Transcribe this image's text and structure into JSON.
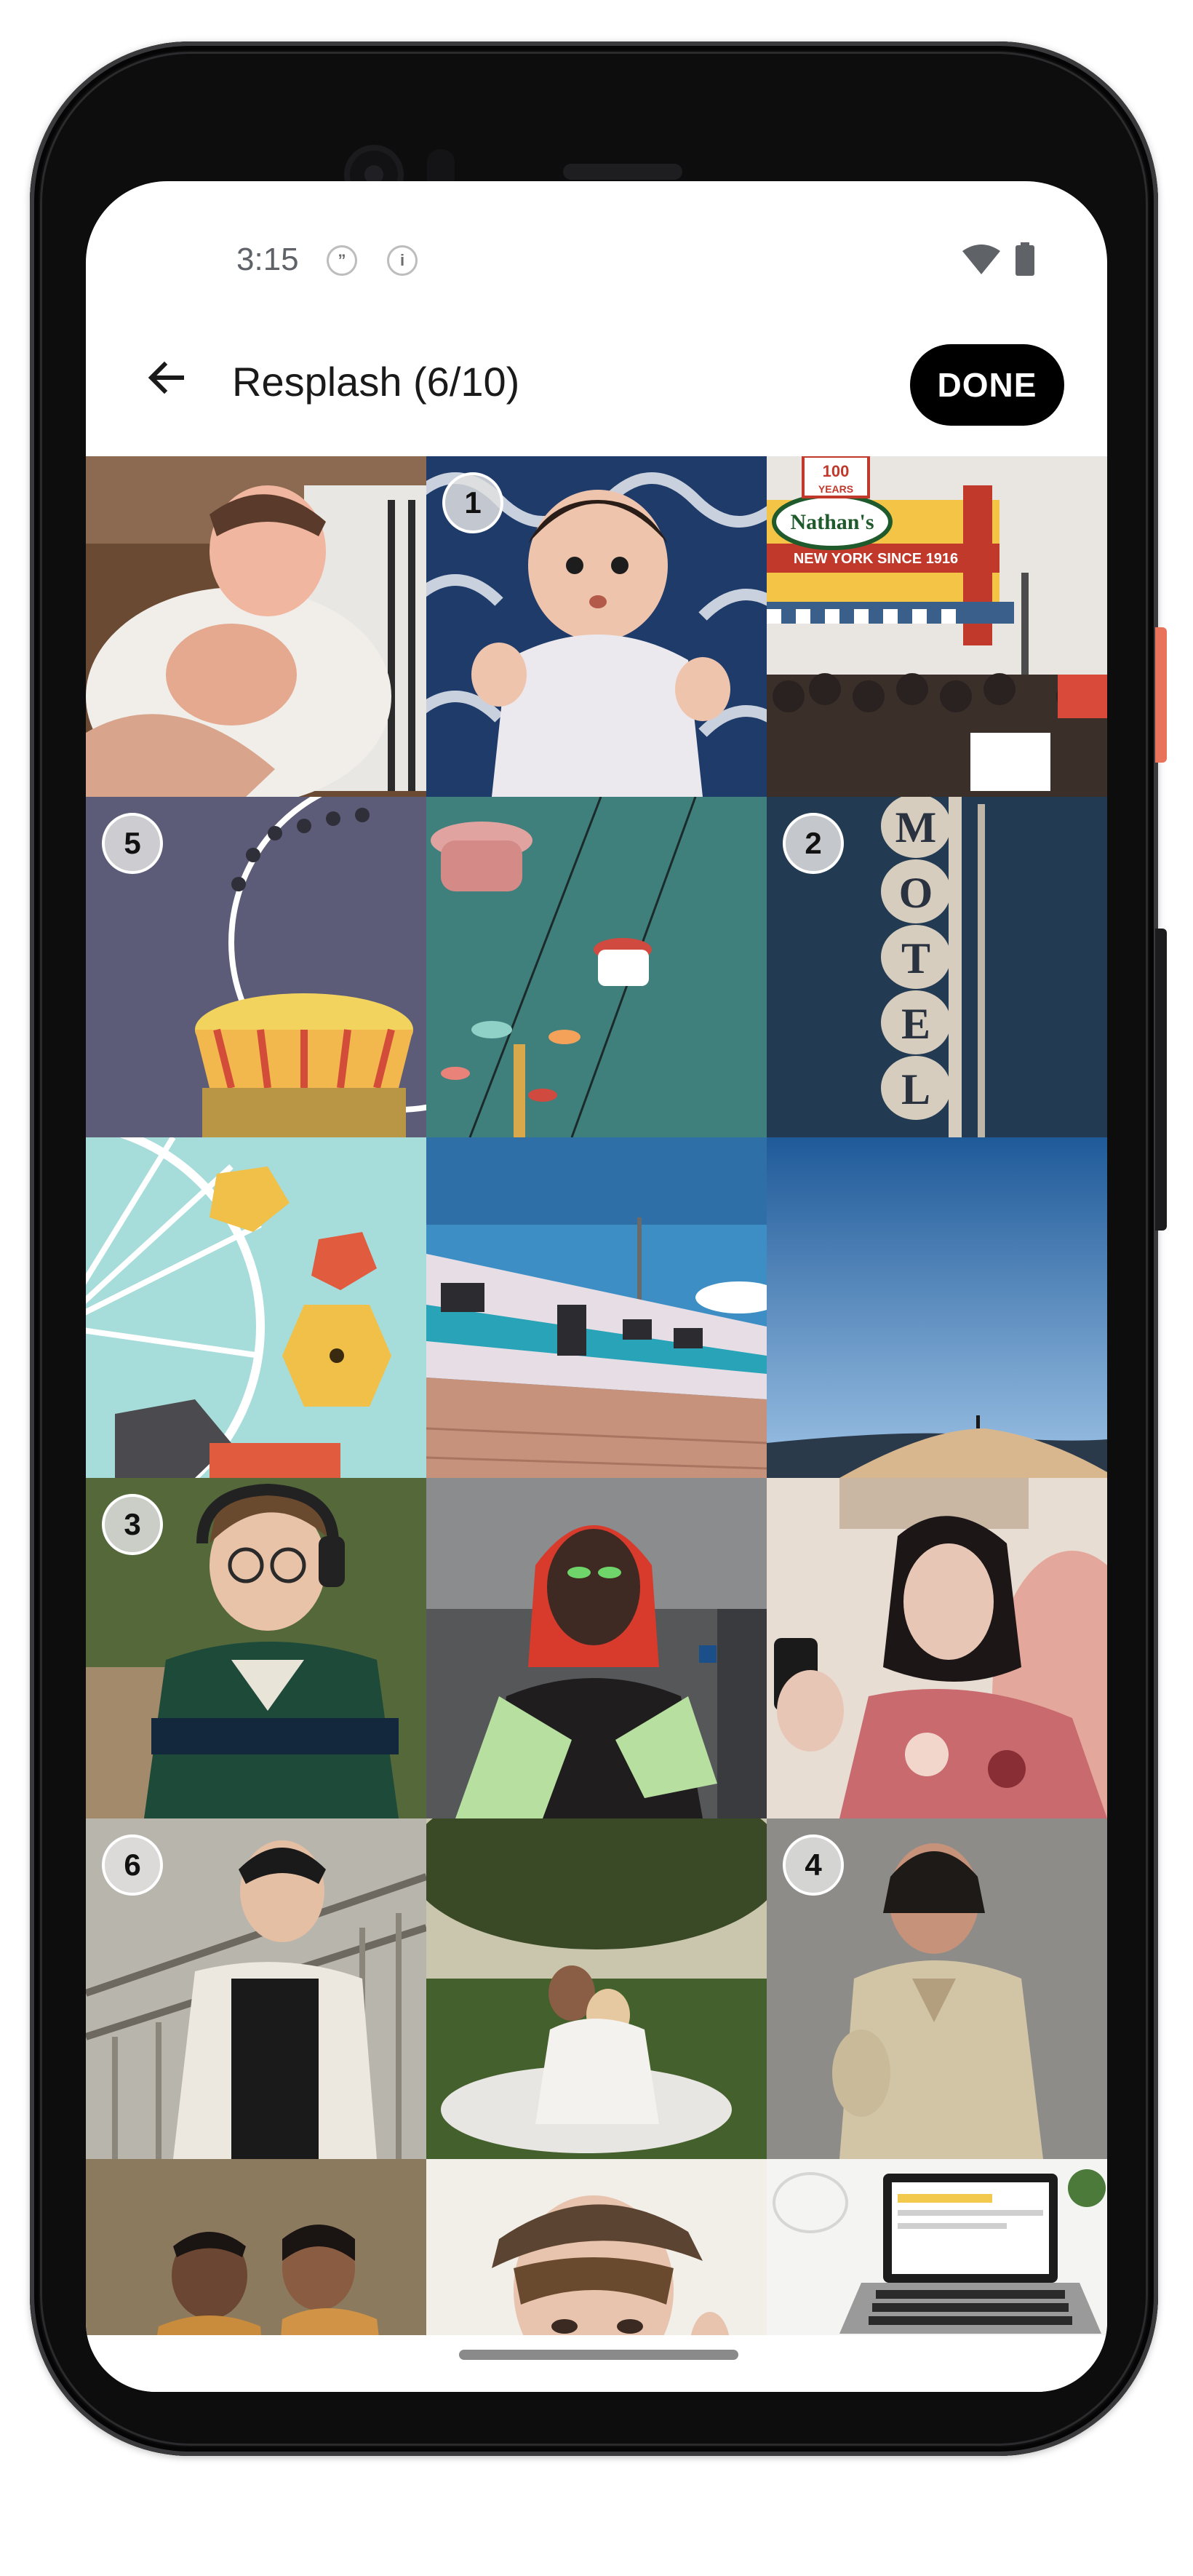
{
  "status_bar": {
    "time": "3:15",
    "notification_icons": [
      "quote-icon",
      "info-icon"
    ],
    "wifi_icon": "wifi-icon",
    "battery_icon": "battery-icon"
  },
  "app_bar": {
    "back_icon": "arrow-left-icon",
    "title": "Resplash (6/10)",
    "done_label": "DONE"
  },
  "colors": {
    "accent": "#000000",
    "badge": "#e1e1e1",
    "phone_side_button": "#e8735a"
  },
  "grid": {
    "tiles": [
      {
        "name": "photo-newborn-baby",
        "badge": ""
      },
      {
        "name": "photo-baby-blue-blanket",
        "badge": "1"
      },
      {
        "name": "photo-nathans-storefront",
        "badge": ""
      },
      {
        "name": "photo-ferris-wheel-swings",
        "badge": "5"
      },
      {
        "name": "photo-sky-ride-gondolas",
        "badge": ""
      },
      {
        "name": "photo-motel-sign",
        "badge": "2"
      },
      {
        "name": "photo-ferris-wheel-yellow-cabins",
        "badge": ""
      },
      {
        "name": "photo-train",
        "badge": ""
      },
      {
        "name": "photo-desert-dune-sky",
        "badge": ""
      },
      {
        "name": "photo-person-headphones",
        "badge": "3"
      },
      {
        "name": "photo-woman-red-scarf",
        "badge": ""
      },
      {
        "name": "photo-woman-phone",
        "badge": ""
      },
      {
        "name": "photo-man-stairs",
        "badge": "6"
      },
      {
        "name": "photo-couple-park",
        "badge": ""
      },
      {
        "name": "photo-woman-khaki",
        "badge": "4"
      },
      {
        "name": "photo-two-people-smiling",
        "badge": ""
      },
      {
        "name": "photo-woman-cap",
        "badge": ""
      },
      {
        "name": "photo-laptop-desk",
        "badge": ""
      }
    ],
    "storefront_sign": {
      "top_line": "100",
      "top_line2": "YEARS",
      "brand": "Nathan's",
      "strip": "NEW YORK SINCE 1916"
    },
    "motel_letters": [
      "M",
      "O",
      "T",
      "E",
      "L"
    ]
  }
}
